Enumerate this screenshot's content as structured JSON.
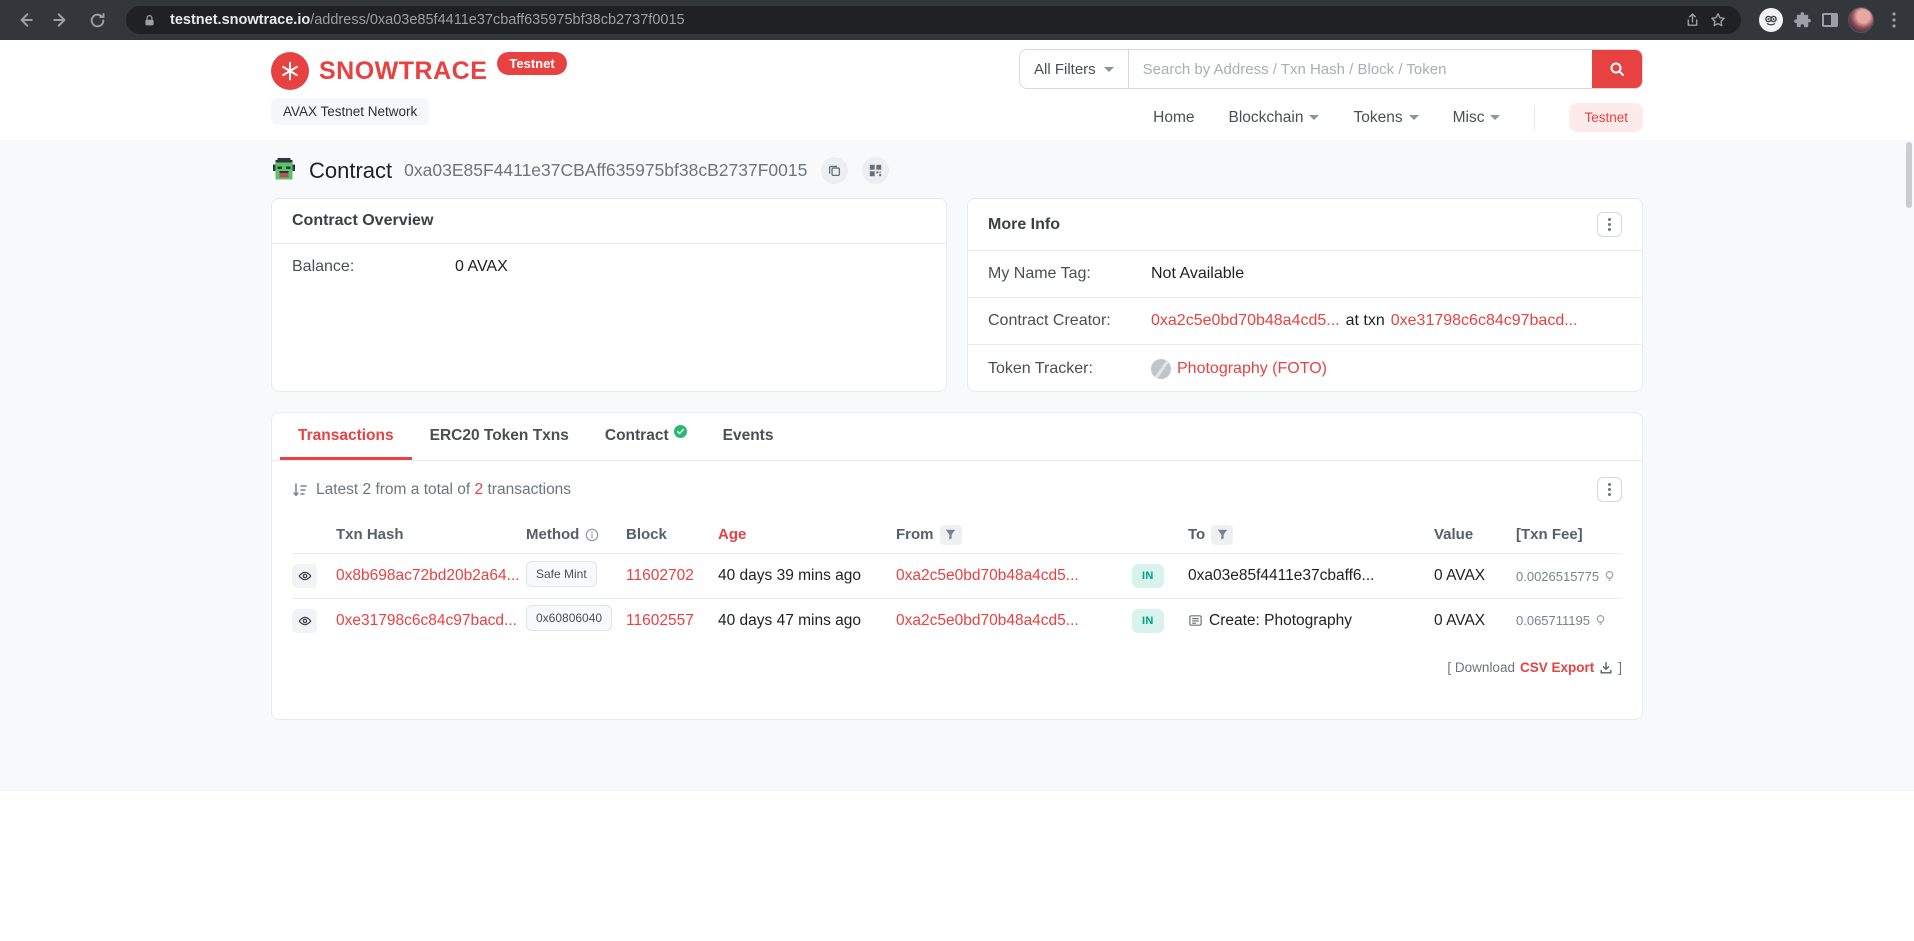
{
  "browser": {
    "domain": "testnet.snowtrace.io",
    "path": "/address/0xa03e85f4411e37cbaff635975bf38cb2737f0015"
  },
  "header": {
    "brand": "SNOWTRACE",
    "brand_badge": "Testnet",
    "network": "AVAX Testnet Network",
    "search": {
      "filter": "All Filters",
      "placeholder": "Search by Address / Txn Hash / Block / Token"
    },
    "nav": [
      {
        "label": "Home"
      },
      {
        "label": "Blockchain"
      },
      {
        "label": "Tokens"
      },
      {
        "label": "Misc"
      }
    ],
    "testnet_button": "Testnet"
  },
  "page": {
    "title": "Contract",
    "address": "0xa03E85F4411e37CBAff635975bf38cB2737F0015"
  },
  "overview": {
    "title": "Contract Overview",
    "balance_label": "Balance:",
    "balance_value": "0 AVAX"
  },
  "more_info": {
    "title": "More Info",
    "name_tag_label": "My Name Tag:",
    "name_tag_value": "Not Available",
    "creator_label": "Contract Creator:",
    "creator_address": "0xa2c5e0bd70b48a4cd5...",
    "creator_connector": "at txn",
    "creator_txn": "0xe31798c6c84c97bacd...",
    "tracker_label": "Token Tracker:",
    "tracker_value": "Photography (FOTO)"
  },
  "tabs": [
    {
      "label": "Transactions"
    },
    {
      "label": "ERC20 Token Txns"
    },
    {
      "label": "Contract"
    },
    {
      "label": "Events"
    }
  ],
  "transactions": {
    "summary_prefix": "Latest 2 from a total of",
    "summary_count": "2",
    "summary_suffix": "transactions",
    "columns": [
      "Txn Hash",
      "Method",
      "Block",
      "Age",
      "From",
      "To",
      "Value",
      "[Txn Fee]"
    ],
    "rows": [
      {
        "hash": "0x8b698ac72bd20b2a64...",
        "method": "Safe Mint",
        "block": "11602702",
        "age": "40 days 39 mins ago",
        "from": "0xa2c5e0bd70b48a4cd5...",
        "direction": "IN",
        "to": "0xa03e85f4411e37cbaff6...",
        "value": "0 AVAX",
        "fee": "0.0026515775"
      },
      {
        "hash": "0xe31798c6c84c97bacd...",
        "method": "0x60806040",
        "block": "11602557",
        "age": "40 days 47 mins ago",
        "from": "0xa2c5e0bd70b48a4cd5...",
        "direction": "IN",
        "to": "Create: Photography",
        "value": "0 AVAX",
        "fee": "0.065711195"
      }
    ],
    "export_prefix": "[ Download",
    "export_link": "CSV Export",
    "export_suffix": "]"
  },
  "colors": {
    "brand_red": "#e84142",
    "link_red": "#e84142",
    "in_badge_bg": "#d7f3ec",
    "in_badge_text": "#00a186",
    "body_bg": "#f8f9fa"
  }
}
